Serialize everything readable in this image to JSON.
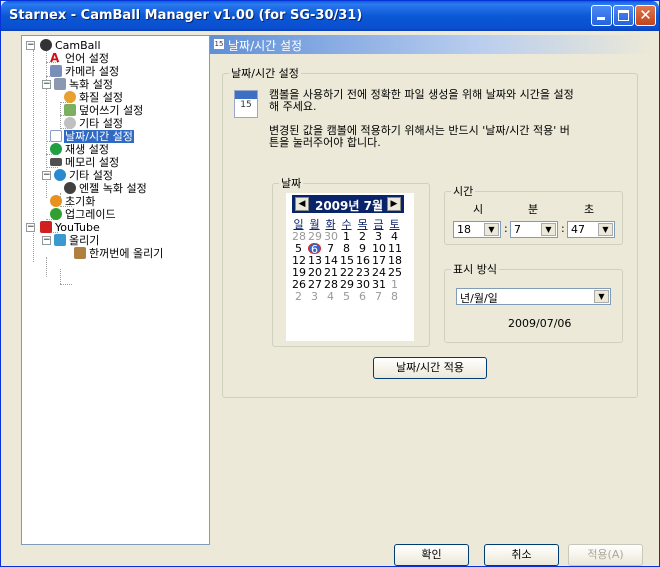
{
  "window": {
    "title": "Starnex - CamBall Manager v1.00 (for SG-30/31)",
    "accent": "#0a5fd8"
  },
  "tree": {
    "items": [
      {
        "label": "CamBall",
        "icon": "camball-icon"
      },
      {
        "label": "언어 설정",
        "icon": "language-icon"
      },
      {
        "label": "카메라 설정",
        "icon": "camera-icon"
      },
      {
        "label": "녹화 설정",
        "icon": "record-icon"
      },
      {
        "label": "화질 설정",
        "icon": "quality-icon"
      },
      {
        "label": "덮어쓰기 설정",
        "icon": "overwrite-icon"
      },
      {
        "label": "기타 설정",
        "icon": "misc-icon"
      },
      {
        "label": "날짜/시간 설정",
        "icon": "calendar-icon"
      },
      {
        "label": "재생 설정",
        "icon": "play-icon"
      },
      {
        "label": "메모리 설정",
        "icon": "memory-icon"
      },
      {
        "label": "기타 설정",
        "icon": "etc-icon"
      },
      {
        "label": "엔젤 녹화 설정",
        "icon": "angel-icon"
      },
      {
        "label": "초기화",
        "icon": "reset-icon"
      },
      {
        "label": "업그레이드",
        "icon": "upgrade-icon"
      },
      {
        "label": "YouTube",
        "icon": "youtube-icon"
      },
      {
        "label": "올리기",
        "icon": "upload-icon"
      },
      {
        "label": "한꺼번에 올리기",
        "icon": "batch-upload-icon"
      }
    ],
    "selected": "날짜/시간 설정"
  },
  "content": {
    "header_title": "날짜/시간 설정",
    "group_title": "날짜/시간 설정",
    "info_line1": "캠볼을 사용하기 전에 정확한 파일 생성을 위해 날짜와 시간을 설정",
    "info_line2": "해 주세요.",
    "info_line3": "변경된 값을 캠볼에 적용하기 위해서는 반드시 '날짜/시간 적용' 버",
    "info_line4": "튼을 눌러주어야 합니다.",
    "calendar_icon_day": "15",
    "date_group": "날짜",
    "time_group": "시간",
    "format_group": "표시 방식",
    "apply_button": "날짜/시간 적용"
  },
  "calendar": {
    "month_label": "2009년 7월",
    "dow": [
      "일",
      "월",
      "화",
      "수",
      "목",
      "금",
      "토"
    ],
    "weeks": [
      [
        "28",
        "29",
        "30",
        "1",
        "2",
        "3",
        "4"
      ],
      [
        "5",
        "6",
        "7",
        "8",
        "9",
        "10",
        "11"
      ],
      [
        "12",
        "13",
        "14",
        "15",
        "16",
        "17",
        "18"
      ],
      [
        "19",
        "20",
        "21",
        "22",
        "23",
        "24",
        "25"
      ],
      [
        "26",
        "27",
        "28",
        "29",
        "30",
        "31",
        "1"
      ],
      [
        "2",
        "3",
        "4",
        "5",
        "6",
        "7",
        "8"
      ]
    ],
    "today": "6"
  },
  "time": {
    "hour_label": "시",
    "minute_label": "분",
    "second_label": "초",
    "hour": "18",
    "minute": "7",
    "second": "47",
    "sep": ":"
  },
  "format": {
    "selected": "년/월/일",
    "preview": "2009/07/06"
  },
  "footer": {
    "ok": "확인",
    "cancel": "취소",
    "apply": "적용(A)"
  }
}
